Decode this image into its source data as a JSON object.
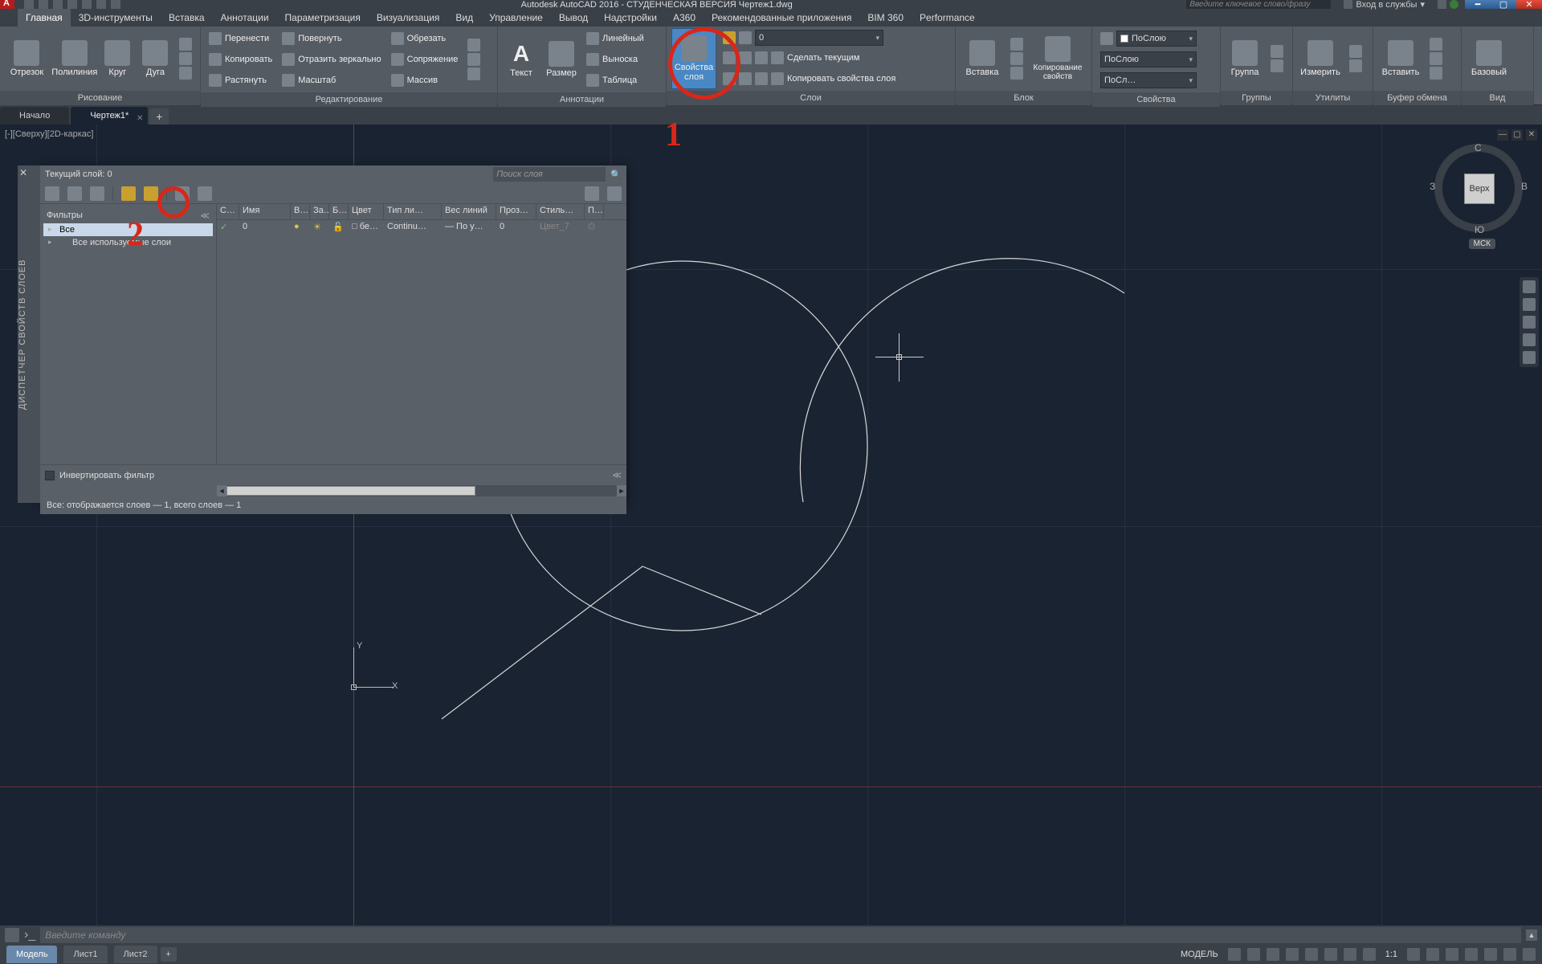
{
  "title": "Autodesk AutoCAD 2016 - СТУДЕНЧЕСКАЯ ВЕРСИЯ   Чертеж1.dwg",
  "search_placeholder": "Введите ключевое слово/фразу",
  "login_label": "Вход в службы",
  "menus": [
    "Главная",
    "3D-инструменты",
    "Вставка",
    "Аннотации",
    "Параметризация",
    "Визуализация",
    "Вид",
    "Управление",
    "Вывод",
    "Надстройки",
    "A360",
    "Рекомендованные приложения",
    "BIM 360",
    "Performance"
  ],
  "ribbon": {
    "draw": {
      "title": "Рисование",
      "btns": [
        "Отрезок",
        "Полилиния",
        "Круг",
        "Дуга"
      ]
    },
    "modify": {
      "title": "Редактирование",
      "rows": [
        [
          "Перенести",
          "Повернуть",
          "Обрезать"
        ],
        [
          "Копировать",
          "Отразить зеркально",
          "Сопряжение"
        ],
        [
          "Растянуть",
          "Масштаб",
          "Массив"
        ]
      ]
    },
    "annot": {
      "title": "Аннотации",
      "big": [
        "Текст",
        "Размер"
      ],
      "rows": [
        "Линейный",
        "Выноска",
        "Таблица"
      ]
    },
    "layers": {
      "title": "Слои",
      "big": "Свойства слоя",
      "dropdown": "0",
      "rows": [
        "Сделать текущим",
        "Копировать свойства слоя"
      ]
    },
    "block": {
      "title": "Блок",
      "big": "Вставка",
      "side": "Копирование свойств"
    },
    "props": {
      "title": "Свойства",
      "color": "ПоСлою",
      "lw": "ПоСлою",
      "lt": "ПоСл…"
    },
    "groups": {
      "title": "Группы",
      "big": "Группа"
    },
    "utils": {
      "title": "Утилиты",
      "big": "Измерить"
    },
    "clip": {
      "title": "Буфер обмена",
      "big": "Вставить"
    },
    "view": {
      "title": "Вид",
      "big": "Базовый"
    }
  },
  "doctabs": {
    "start": "Начало",
    "active": "Чертеж1*"
  },
  "viewport_label": "[-][Сверху][2D-каркас]",
  "viewcube": {
    "face": "Верх",
    "n": "С",
    "s": "Ю",
    "e": "В",
    "w": "З",
    "wcs": "МСК"
  },
  "ucs": {
    "x": "X",
    "y": "Y"
  },
  "palette": {
    "sidebar": "ДИСПЕТЧЕР СВОЙСТВ СЛОЕВ",
    "current": "Текущий слой: 0",
    "search": "Поиск слоя",
    "filters_label": "Фильтры",
    "tree": {
      "root": "Все",
      "child": "Все используемые слои"
    },
    "columns": [
      "С…",
      "Имя",
      "В…",
      "За…",
      "Б…",
      "Цвет",
      "Тип ли…",
      "Вес линий",
      "Проз…",
      "Стиль…",
      "П…"
    ],
    "row": {
      "status": "✓",
      "name": "0",
      "color_swatch": "□",
      "color": "бе…",
      "ltype": "Continu…",
      "lweight": "— По у…",
      "trans": "0",
      "style": "Цвет_7"
    },
    "invert": "Инвертировать фильтр",
    "status": "Все: отображается слоев — 1, всего слоев — 1"
  },
  "annotations": {
    "label1": "1",
    "label2": "2"
  },
  "cmd_placeholder": "Введите  команду",
  "statusbar": {
    "tabs": [
      "Модель",
      "Лист1",
      "Лист2"
    ],
    "model_label": "МОДЕЛЬ",
    "scale": "1:1"
  }
}
